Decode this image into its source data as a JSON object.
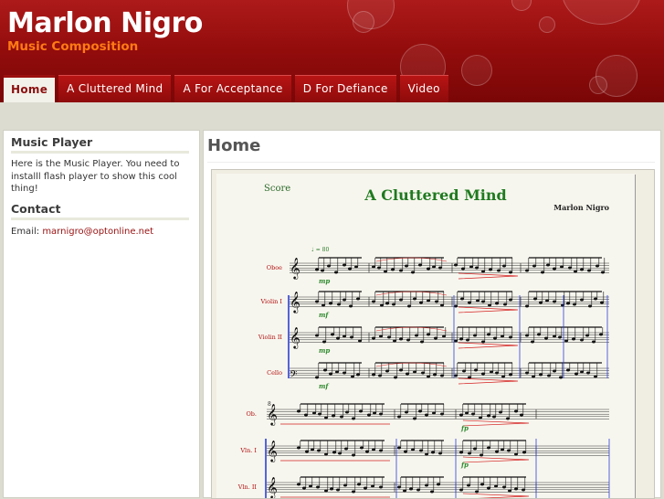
{
  "site": {
    "title": "Marlon Nigro",
    "subtitle": "Music Composition"
  },
  "nav": {
    "items": [
      {
        "label": "Home",
        "active": true
      },
      {
        "label": "A Cluttered Mind",
        "active": false
      },
      {
        "label": "A For Acceptance",
        "active": false
      },
      {
        "label": "D For Defiance",
        "active": false
      },
      {
        "label": "Video",
        "active": false
      }
    ]
  },
  "sidebar": {
    "music_player": {
      "heading": "Music Player",
      "text": "Here is the Music Player. You need to installl flash player to show this cool thing!"
    },
    "contact": {
      "heading": "Contact",
      "label": "Email:",
      "email": "marnigro@optonline.net"
    }
  },
  "main": {
    "title": "Home",
    "score": {
      "label": "Score",
      "title": "A Cluttered Mind",
      "composer": "Marlon Nigro",
      "tempo": "♩ = 80",
      "system1_instruments": [
        "Oboe",
        "Violin I",
        "Violin II",
        "Cello"
      ],
      "system2_instruments": [
        "Ob.",
        "Vln. I",
        "Vln. II"
      ],
      "measure_number": "8"
    }
  },
  "colors": {
    "header_red": "#950d0d",
    "subtitle_orange": "#ff7a14",
    "link_red": "#9a1111",
    "score_title_green": "#1f7a1f",
    "dynamics_green": "#2f8a2f",
    "annotation_red": "#d42020",
    "barline_blue": "#2b3fd8"
  }
}
